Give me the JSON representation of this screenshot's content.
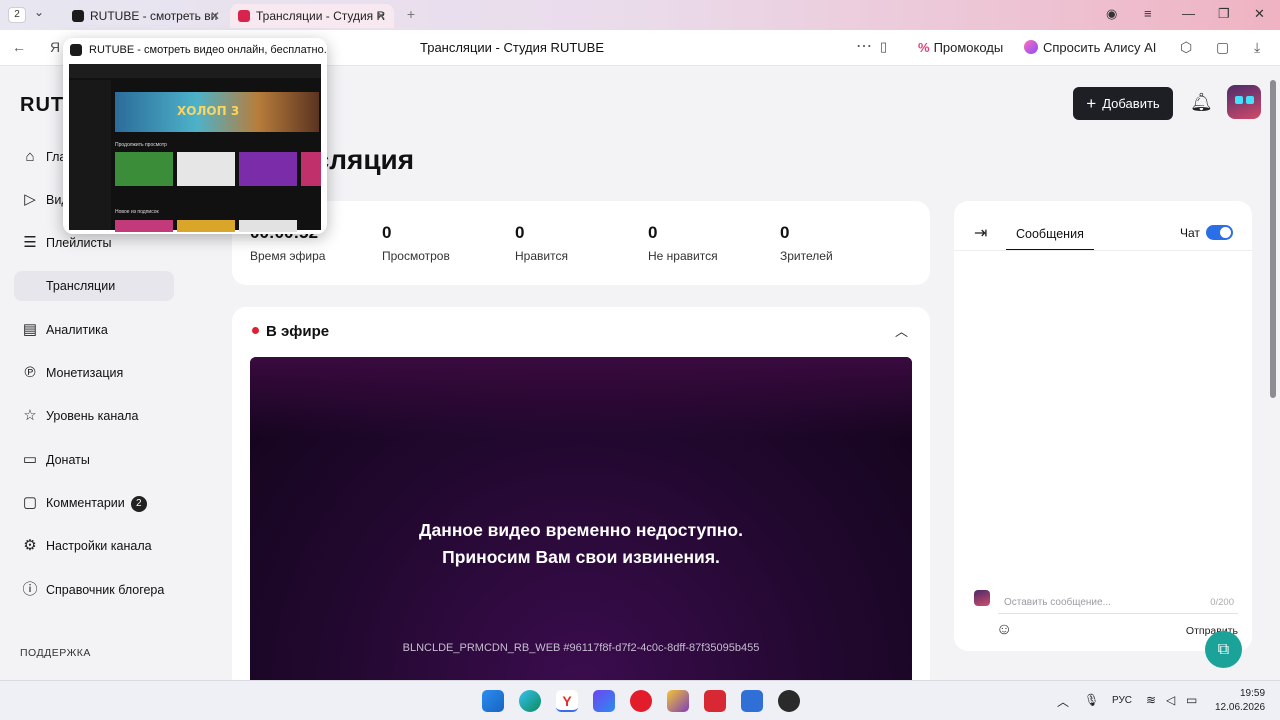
{
  "browser": {
    "tab_count": "2",
    "tabs": [
      {
        "title": "RUTUBE - смотреть ви"
      },
      {
        "title": "Трансляции - Студия R"
      }
    ],
    "page_title": "Трансляции - Студия RUTUBE",
    "promo_label": "Промокоды",
    "alice_label": "Спросить Алису AI",
    "preview": {
      "title": "RUTUBE - смотреть видео онлайн, бесплатно...",
      "banner_text": "ХОЛОП 3",
      "section1": "Продолжить просмотр",
      "section2": "Новое из подписок"
    }
  },
  "app": {
    "logo": "RUTUBE",
    "add_button": "Добавить",
    "page_title": "Трансляция",
    "colors": {
      "accent": "#1e1f24",
      "live": "#e02030",
      "toggle": "#2a6fe8",
      "fab": "#1ba399"
    }
  },
  "sidebar": {
    "items": [
      {
        "label": "Главная",
        "icon": "home-icon"
      },
      {
        "label": "Видео",
        "icon": "video-icon"
      },
      {
        "label": "Плейлисты",
        "icon": "playlist-icon"
      },
      {
        "label": "Трансляции",
        "icon": "broadcast-icon",
        "active": true
      },
      {
        "label": "Аналитика",
        "icon": "analytics-icon"
      },
      {
        "label": "Монетизация",
        "icon": "monetization-icon"
      },
      {
        "label": "Уровень канала",
        "icon": "star-icon"
      },
      {
        "label": "Донаты",
        "icon": "donate-icon"
      },
      {
        "label": "Комментарии",
        "icon": "comments-icon",
        "badge": "2"
      },
      {
        "label": "Настройки канала",
        "icon": "settings-icon"
      },
      {
        "label": "Справочник блогера",
        "icon": "info-icon"
      }
    ],
    "section_support": "ПОДДЕРЖКА"
  },
  "stats": [
    {
      "value": "00:00:52",
      "label": "Время эфира"
    },
    {
      "value": "0",
      "label": "Просмотров"
    },
    {
      "value": "0",
      "label": "Нравится"
    },
    {
      "value": "0",
      "label": "Не нравится"
    },
    {
      "value": "0",
      "label": "Зрителей"
    }
  ],
  "live": {
    "header": "В эфире",
    "message_line1": "Данное видео временно недоступно.",
    "message_line2": "Приносим Вам свои извинения.",
    "error_code": "BLNCLDE_PRMCDN_RB_WEB #96117f8f-d7f2-4c0c-8dff-87f35095b455"
  },
  "chat": {
    "tab_messages": "Сообщения",
    "chat_label": "Чат",
    "chat_enabled": true,
    "input_placeholder": "Оставить сообщение...",
    "char_count": "0/200",
    "send_label": "Отправить"
  },
  "taskbar": {
    "lang": "РУС",
    "time": "19:59",
    "date": "12.06.2026"
  }
}
